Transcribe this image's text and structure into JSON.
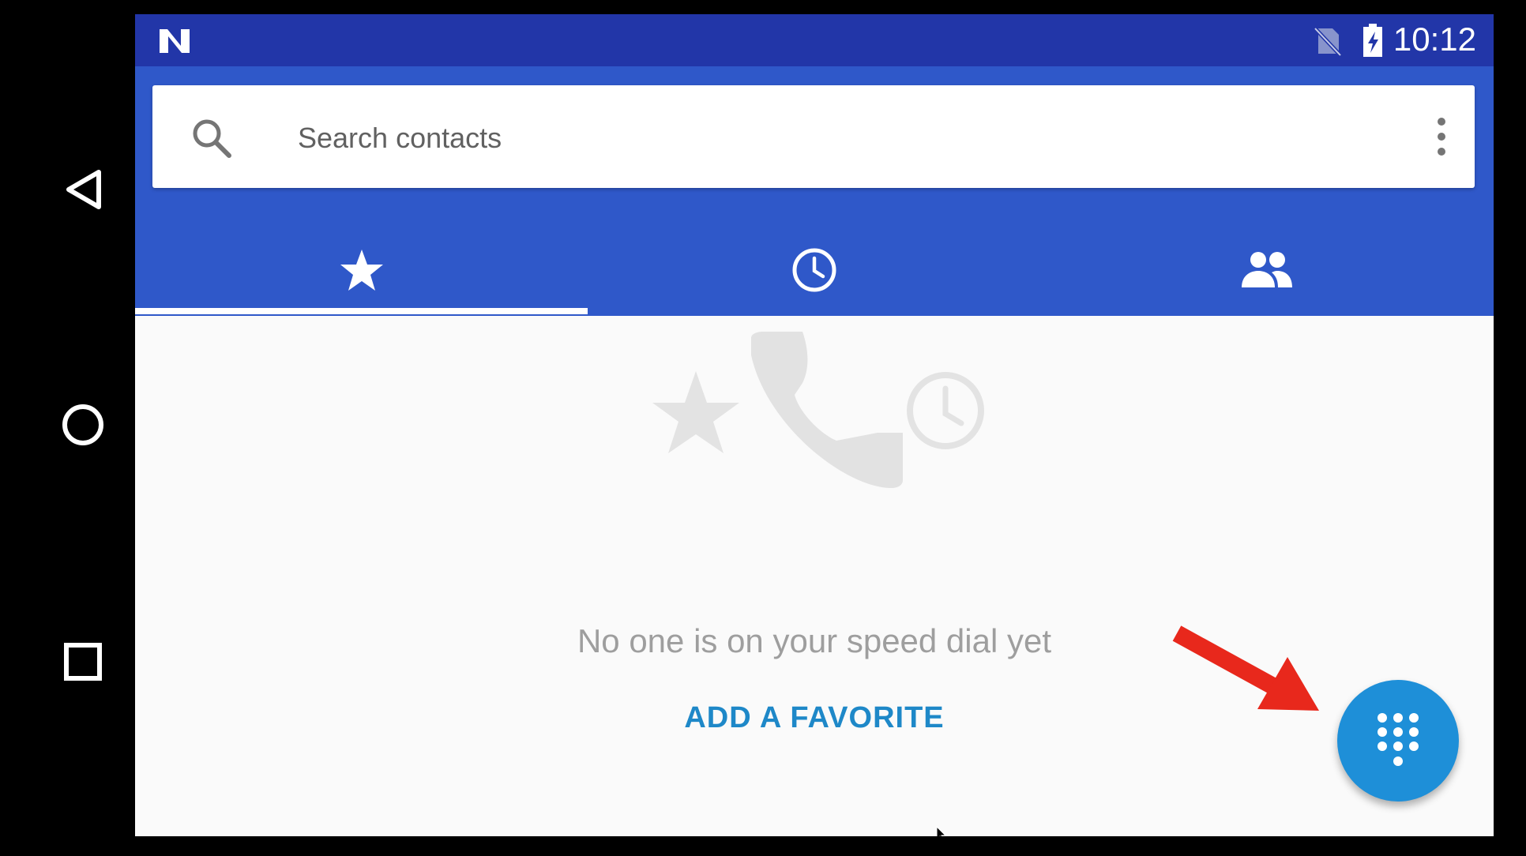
{
  "navigation": {
    "back_icon": "triangle-back-icon",
    "home_icon": "circle-home-icon",
    "recents_icon": "square-recents-icon"
  },
  "status_bar": {
    "logo_icon": "n-logo-icon",
    "no_sim_icon": "no-sim-icon",
    "battery_icon": "battery-charging-icon",
    "time": "10:12"
  },
  "search": {
    "placeholder": "Search contacts",
    "search_icon": "search-icon",
    "menu_icon": "more-vert-icon"
  },
  "tabs": [
    {
      "name": "speed-dial",
      "icon": "star-icon",
      "selected": true
    },
    {
      "name": "recents",
      "icon": "clock-icon",
      "selected": false
    },
    {
      "name": "contacts",
      "icon": "people-icon",
      "selected": false
    }
  ],
  "empty_state": {
    "message": "No one is on your speed dial yet",
    "action": "ADD A FAVORITE"
  },
  "fab": {
    "icon": "dialpad-icon"
  },
  "colors": {
    "status_bar": "#2236a8",
    "app_bar": "#2f58c9",
    "accent": "#1e8fd8",
    "annotation_arrow": "#e8281c"
  }
}
